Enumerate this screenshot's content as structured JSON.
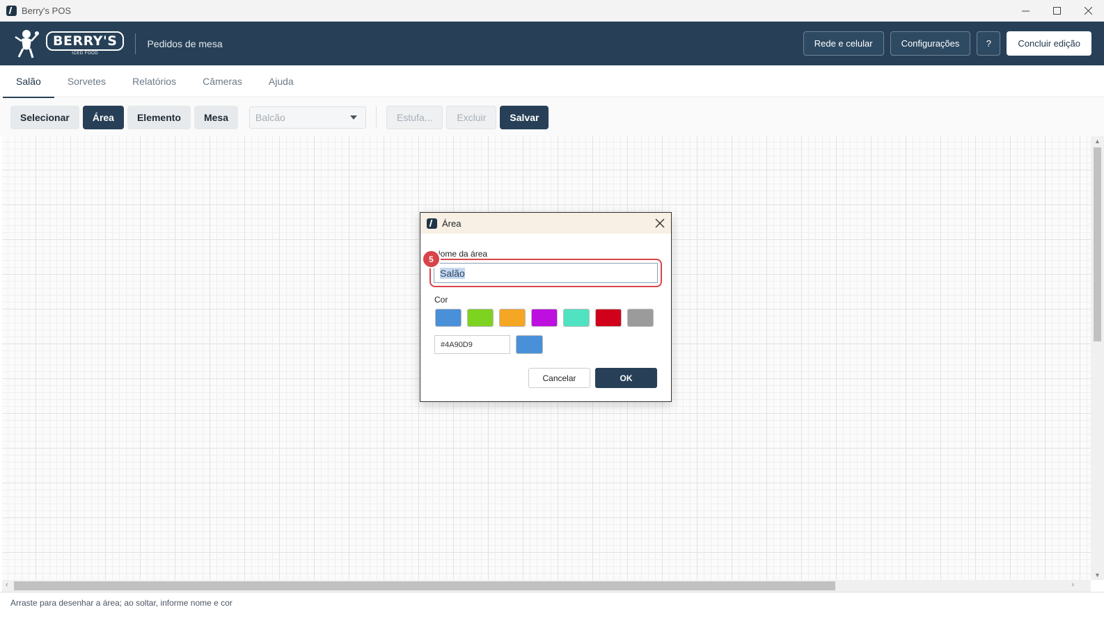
{
  "window": {
    "title": "Berry's POS",
    "minimize_icon": "minimize-icon",
    "maximize_icon": "maximize-icon",
    "close_icon": "close-icon"
  },
  "header": {
    "brand": "BERRY'S",
    "brand_sub": "ICED FOOD",
    "section_title": "Pedidos de mesa",
    "actions": {
      "network": "Rede e celular",
      "settings": "Configurações",
      "help": "?",
      "finish": "Concluir edição"
    }
  },
  "tabs": [
    {
      "label": "Salão",
      "active": true
    },
    {
      "label": "Sorvetes"
    },
    {
      "label": "Relatórios"
    },
    {
      "label": "Câmeras"
    },
    {
      "label": "Ajuda"
    }
  ],
  "toolbar": {
    "select": "Selecionar",
    "area": "Área",
    "element": "Elemento",
    "table": "Mesa",
    "area_dropdown_value": "Balcão",
    "stove": "Estufa...",
    "delete": "Excluir",
    "save": "Salvar"
  },
  "status_text": "Arraste para desenhar a área; ao soltar, informe nome e cor",
  "dialog": {
    "title": "Área",
    "name_label": "Nome da área",
    "name_value": "Salão",
    "step_badge": "5",
    "color_label": "Cor",
    "swatches": [
      "#4A90D9",
      "#7ED321",
      "#F5A623",
      "#BD10E0",
      "#50E3C2",
      "#D0021B",
      "#9B9B9B"
    ],
    "hex_value": "#4A90D9",
    "preview_color": "#4A90D9",
    "cancel": "Cancelar",
    "ok": "OK"
  },
  "colors": {
    "header_bg": "#274057",
    "accent": "#274057",
    "highlight": "#D9434A"
  }
}
